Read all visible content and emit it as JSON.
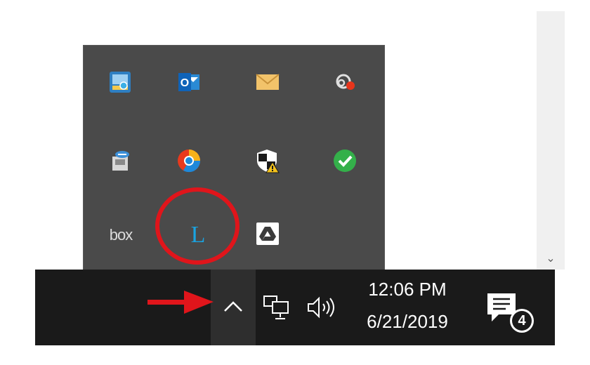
{
  "scrollbar": {
    "down_arrow": "⌄"
  },
  "tray": {
    "icons": [
      {
        "name": "network-folder-icon"
      },
      {
        "name": "outlook-icon",
        "label": "O"
      },
      {
        "name": "mail-icon"
      },
      {
        "name": "cloud-sync-error-icon"
      },
      {
        "name": "usb-eject-icon"
      },
      {
        "name": "chrome-canary-icon"
      },
      {
        "name": "security-warning-icon"
      },
      {
        "name": "green-check-icon"
      },
      {
        "name": "box-icon",
        "label": "box"
      },
      {
        "name": "l-app-icon",
        "label": "L"
      },
      {
        "name": "google-drive-icon"
      }
    ]
  },
  "taskbar": {
    "time": "12:06 PM",
    "date": "6/21/2019",
    "notification_count": "4"
  },
  "colors": {
    "tray_bg": "#4a4a4a",
    "taskbar_bg": "#1a1a1a",
    "annotation_red": "#e0151b",
    "l_icon_blue": "#1aa3e0"
  }
}
